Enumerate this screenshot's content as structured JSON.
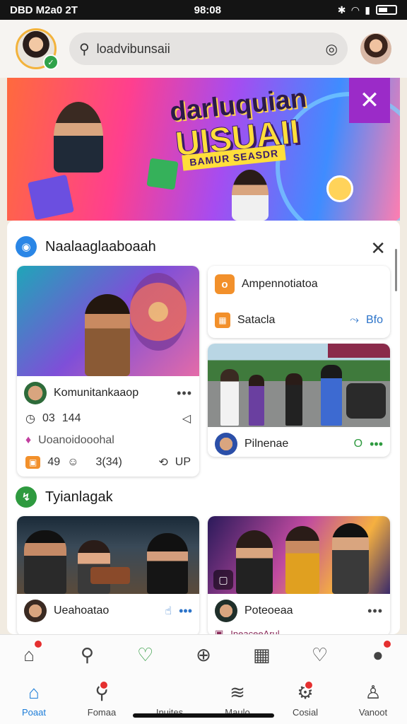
{
  "status_bar": {
    "left": "DBD M2a0 2T",
    "time": "98:08"
  },
  "search": {
    "text": "loadvibunsaii"
  },
  "banner": {
    "title": "darluquian",
    "subtitle": "UISUAII",
    "tagline": "BAMUR SEASDR",
    "close": "✕"
  },
  "section1": {
    "title": "Naalaaglaaboaah",
    "card1": {
      "author": "Komunitankaaop",
      "meta_a": "03",
      "meta_b": "144",
      "subtitle": "Uoanoidooohal",
      "likes": "49",
      "comments": "3(34)",
      "shares": "UP"
    },
    "card2": {
      "title": "Ampennotiatoa",
      "subtitle": "Satacla",
      "action": "Bfo"
    },
    "card3": {
      "author": "Pilnenae",
      "action": "O"
    }
  },
  "section2": {
    "title": "Tyianlagak",
    "card4": {
      "author": "Ueahoatao"
    },
    "card5": {
      "author": "Poteoeaa",
      "extra": "IneaceeArul"
    }
  },
  "bottom_nav": {
    "tabs": [
      {
        "label": "Poaat"
      },
      {
        "label": "Fomaa"
      },
      {
        "label": "Inuites"
      },
      {
        "label": "Maulo"
      },
      {
        "label": "Cosial"
      },
      {
        "label": "Vanoot"
      }
    ]
  }
}
